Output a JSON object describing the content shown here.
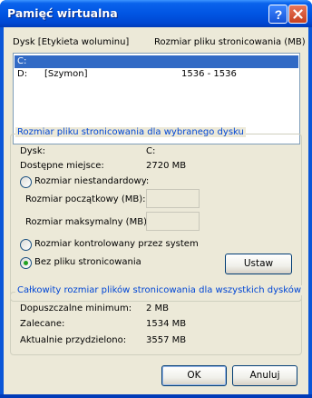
{
  "window": {
    "title": "Pamięć wirtualna"
  },
  "drive_list": {
    "header_drive": "Dysk [Etykieta woluminu]",
    "header_size": "Rozmiar pliku stronicowania (MB)",
    "rows": [
      {
        "drive": "C:",
        "label": "",
        "size": "",
        "selected": true
      },
      {
        "drive": "D:",
        "label": "[Szymon]",
        "size": "1536 - 1536",
        "selected": false
      }
    ]
  },
  "selected_drive_group": {
    "title": "Rozmiar pliku stronicowania dla wybranego dysku",
    "drive_label": "Dysk:",
    "drive_value": "C:",
    "free_label": "Dostępne miejsce:",
    "free_value": "2720 MB",
    "custom_size_label": "Rozmiar niestandardowy:",
    "initial_size_label": "Rozmiar początkowy (MB):",
    "initial_size_value": "",
    "max_size_label": "Rozmiar maksymalny (MB):",
    "max_size_value": "",
    "system_managed_label": "Rozmiar kontrolowany przez system",
    "no_paging_label": "Bez pliku stronicowania",
    "selected_option": "no_paging",
    "set_button": "Ustaw"
  },
  "total_group": {
    "title": "Całkowity rozmiar plików stronicowania dla wszystkich dysków",
    "min_label": "Dopuszczalne minimum:",
    "min_value": "2 MB",
    "recommended_label": "Zalecane:",
    "recommended_value": "1534 MB",
    "allocated_label": "Aktualnie przydzielono:",
    "allocated_value": "3557 MB"
  },
  "buttons": {
    "ok": "OK",
    "cancel": "Anuluj"
  },
  "colors": {
    "titlebar": "#0155e3",
    "dialog_bg": "#ece9d8",
    "selection": "#316ac5",
    "group_title": "#0046d5",
    "radio_checked": "#21a121"
  }
}
